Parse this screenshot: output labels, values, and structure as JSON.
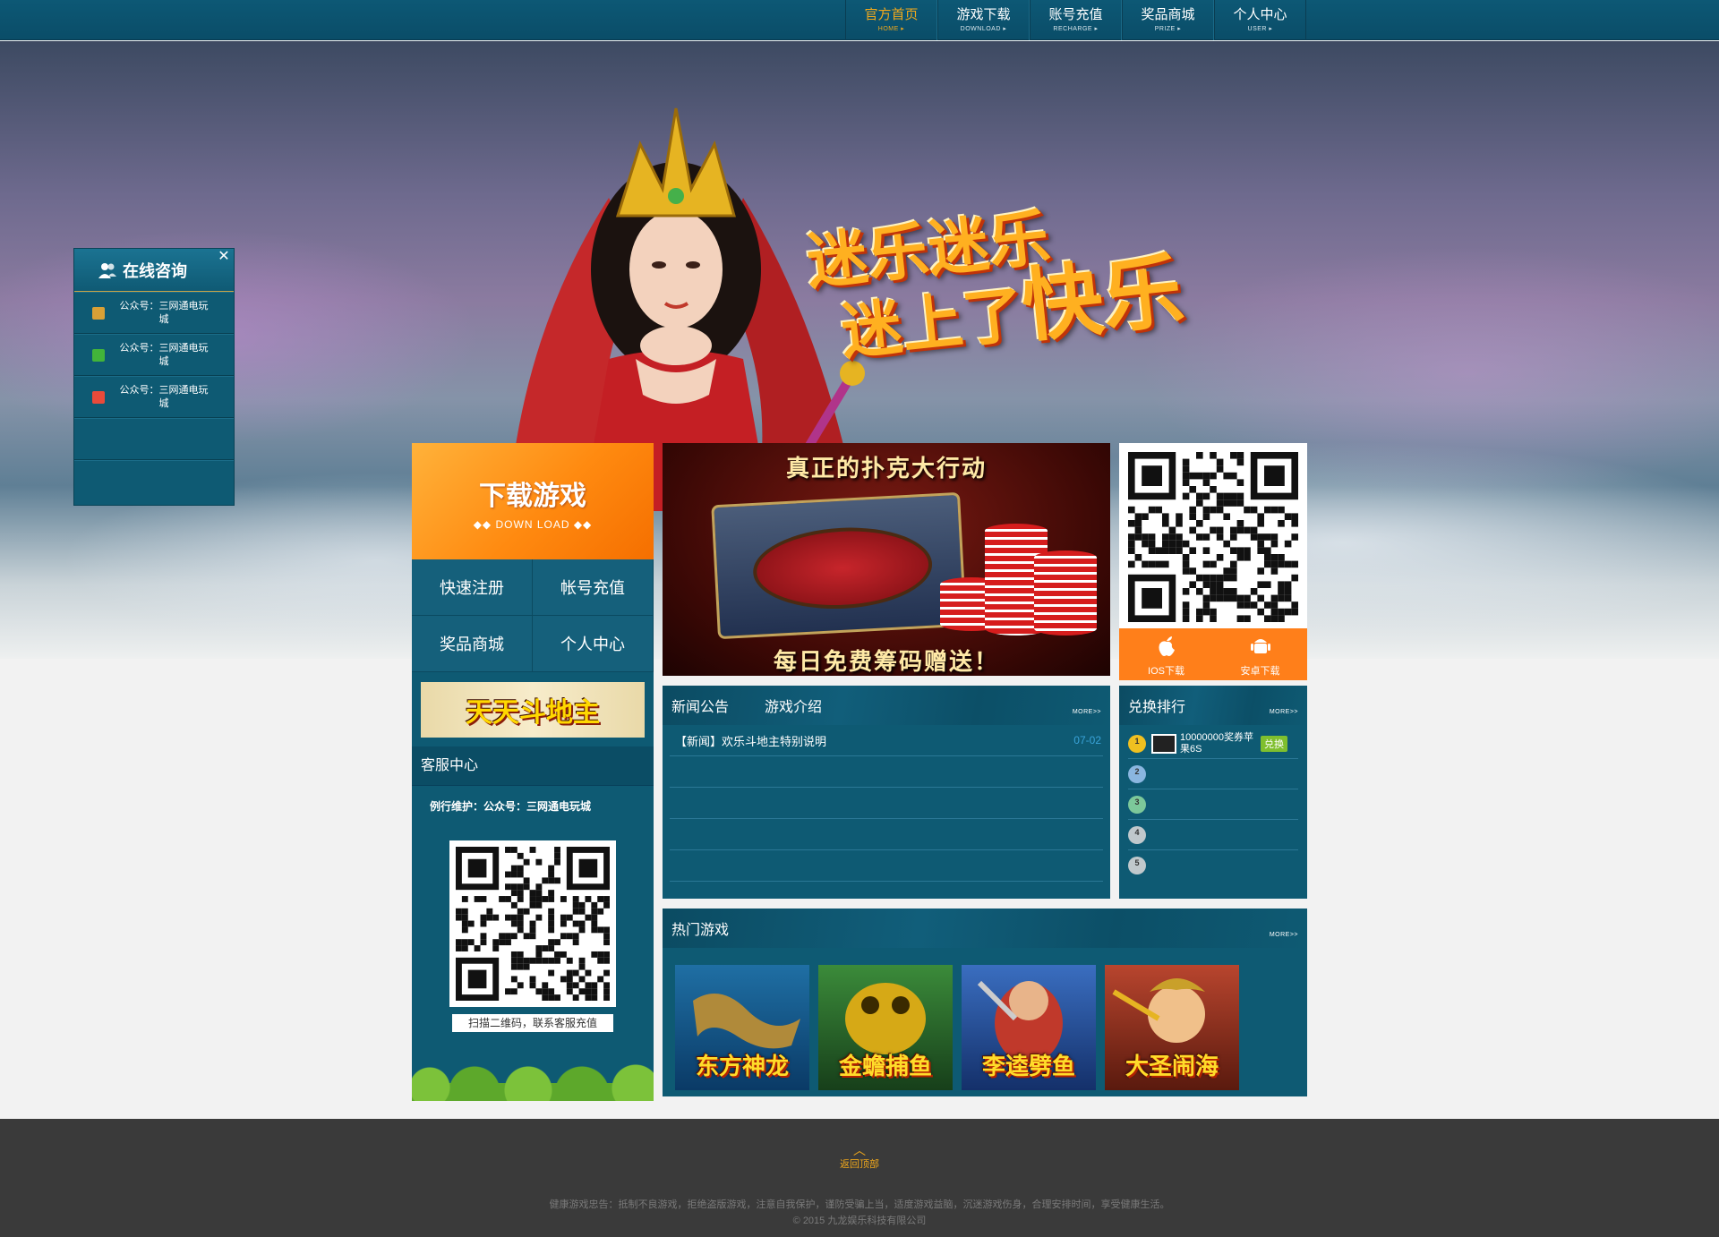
{
  "nav": {
    "items": [
      {
        "label": "官方首页",
        "sub": "HOME ▸",
        "active": true
      },
      {
        "label": "游戏下载",
        "sub": "DOWNLOAD ▸",
        "active": false
      },
      {
        "label": "账号充值",
        "sub": "RECHARGE ▸",
        "active": false
      },
      {
        "label": "奖品商城",
        "sub": "PRIZE ▸",
        "active": false
      },
      {
        "label": "个人中心",
        "sub": "USER ▸",
        "active": false
      }
    ]
  },
  "hero": {
    "logo_line1": "迷乐迷乐",
    "logo_line2a": "迷上了",
    "logo_line2b": "快乐"
  },
  "consult": {
    "title": "在线咨询",
    "close": "✕",
    "items": [
      {
        "text": "公众号：三网通电玩城",
        "icon_color": "#d8a036",
        "icon": "qq-icon"
      },
      {
        "text": "公众号：三网通电玩城",
        "icon_color": "#42b43a",
        "icon": "wechat-icon"
      },
      {
        "text": "公众号：三网通电玩城",
        "icon_color": "#e94a3a",
        "icon": "weibo-icon"
      }
    ]
  },
  "left": {
    "download_cn": "下载游戏",
    "download_en": "◆◆ DOWN LOAD ◆◆",
    "quick": [
      "快速注册",
      "帐号充值",
      "奖品商城",
      "个人中心"
    ],
    "ddz_banner": "天天斗地主",
    "service_title": "客服中心",
    "maintenance": "例行维护：公众号：三网通电玩城",
    "qr_caption": "扫描二维码，联系客服充值"
  },
  "banner": {
    "top_text": "真正的扑克大行动",
    "bottom_text": "每日免费筹码赠送！"
  },
  "download_card": {
    "ios_label": "IOS下载",
    "android_label": "安卓下载"
  },
  "news": {
    "tab1": "新闻公告",
    "tab2": "游戏介绍",
    "more": "MORE>>",
    "rows": [
      {
        "title": "【新闻】欢乐斗地主特别说明",
        "date": "07-02"
      },
      {
        "title": "",
        "date": ""
      },
      {
        "title": "",
        "date": ""
      },
      {
        "title": "",
        "date": ""
      },
      {
        "title": "",
        "date": ""
      }
    ]
  },
  "rank": {
    "title": "兑换排行",
    "more": "MORE>>",
    "rows": [
      {
        "n": "1",
        "name": "10000000奖券苹果6S",
        "button": "兑换",
        "medal_color": "#f0c020"
      },
      {
        "n": "2",
        "name": "",
        "button": "",
        "medal_color": "#8ab6e0"
      },
      {
        "n": "3",
        "name": "",
        "button": "",
        "medal_color": "#7cc89a"
      },
      {
        "n": "4",
        "name": "",
        "button": "",
        "medal_color": "#c0c8cc"
      },
      {
        "n": "5",
        "name": "",
        "button": "",
        "medal_color": "#c0c8cc"
      }
    ]
  },
  "hot": {
    "title": "热门游戏",
    "more": "MORE>>",
    "games": [
      {
        "name": "东方神龙",
        "bg": "#1f6fa4"
      },
      {
        "name": "金蟾捕鱼",
        "bg": "#2b7a3a"
      },
      {
        "name": "李逵劈鱼",
        "bg": "#2d5fa8"
      },
      {
        "name": "大圣闹海",
        "bg": "#a83a2a"
      }
    ]
  },
  "footer": {
    "back_top": "返回顶部",
    "notice": "健康游戏忠告：抵制不良游戏，拒绝盗版游戏，注意自我保护，谨防受骗上当，适度游戏益脑，沉迷游戏伤身，合理安排时间，享受健康生活。",
    "copyright": "© 2015 九龙娱乐科技有限公司"
  }
}
